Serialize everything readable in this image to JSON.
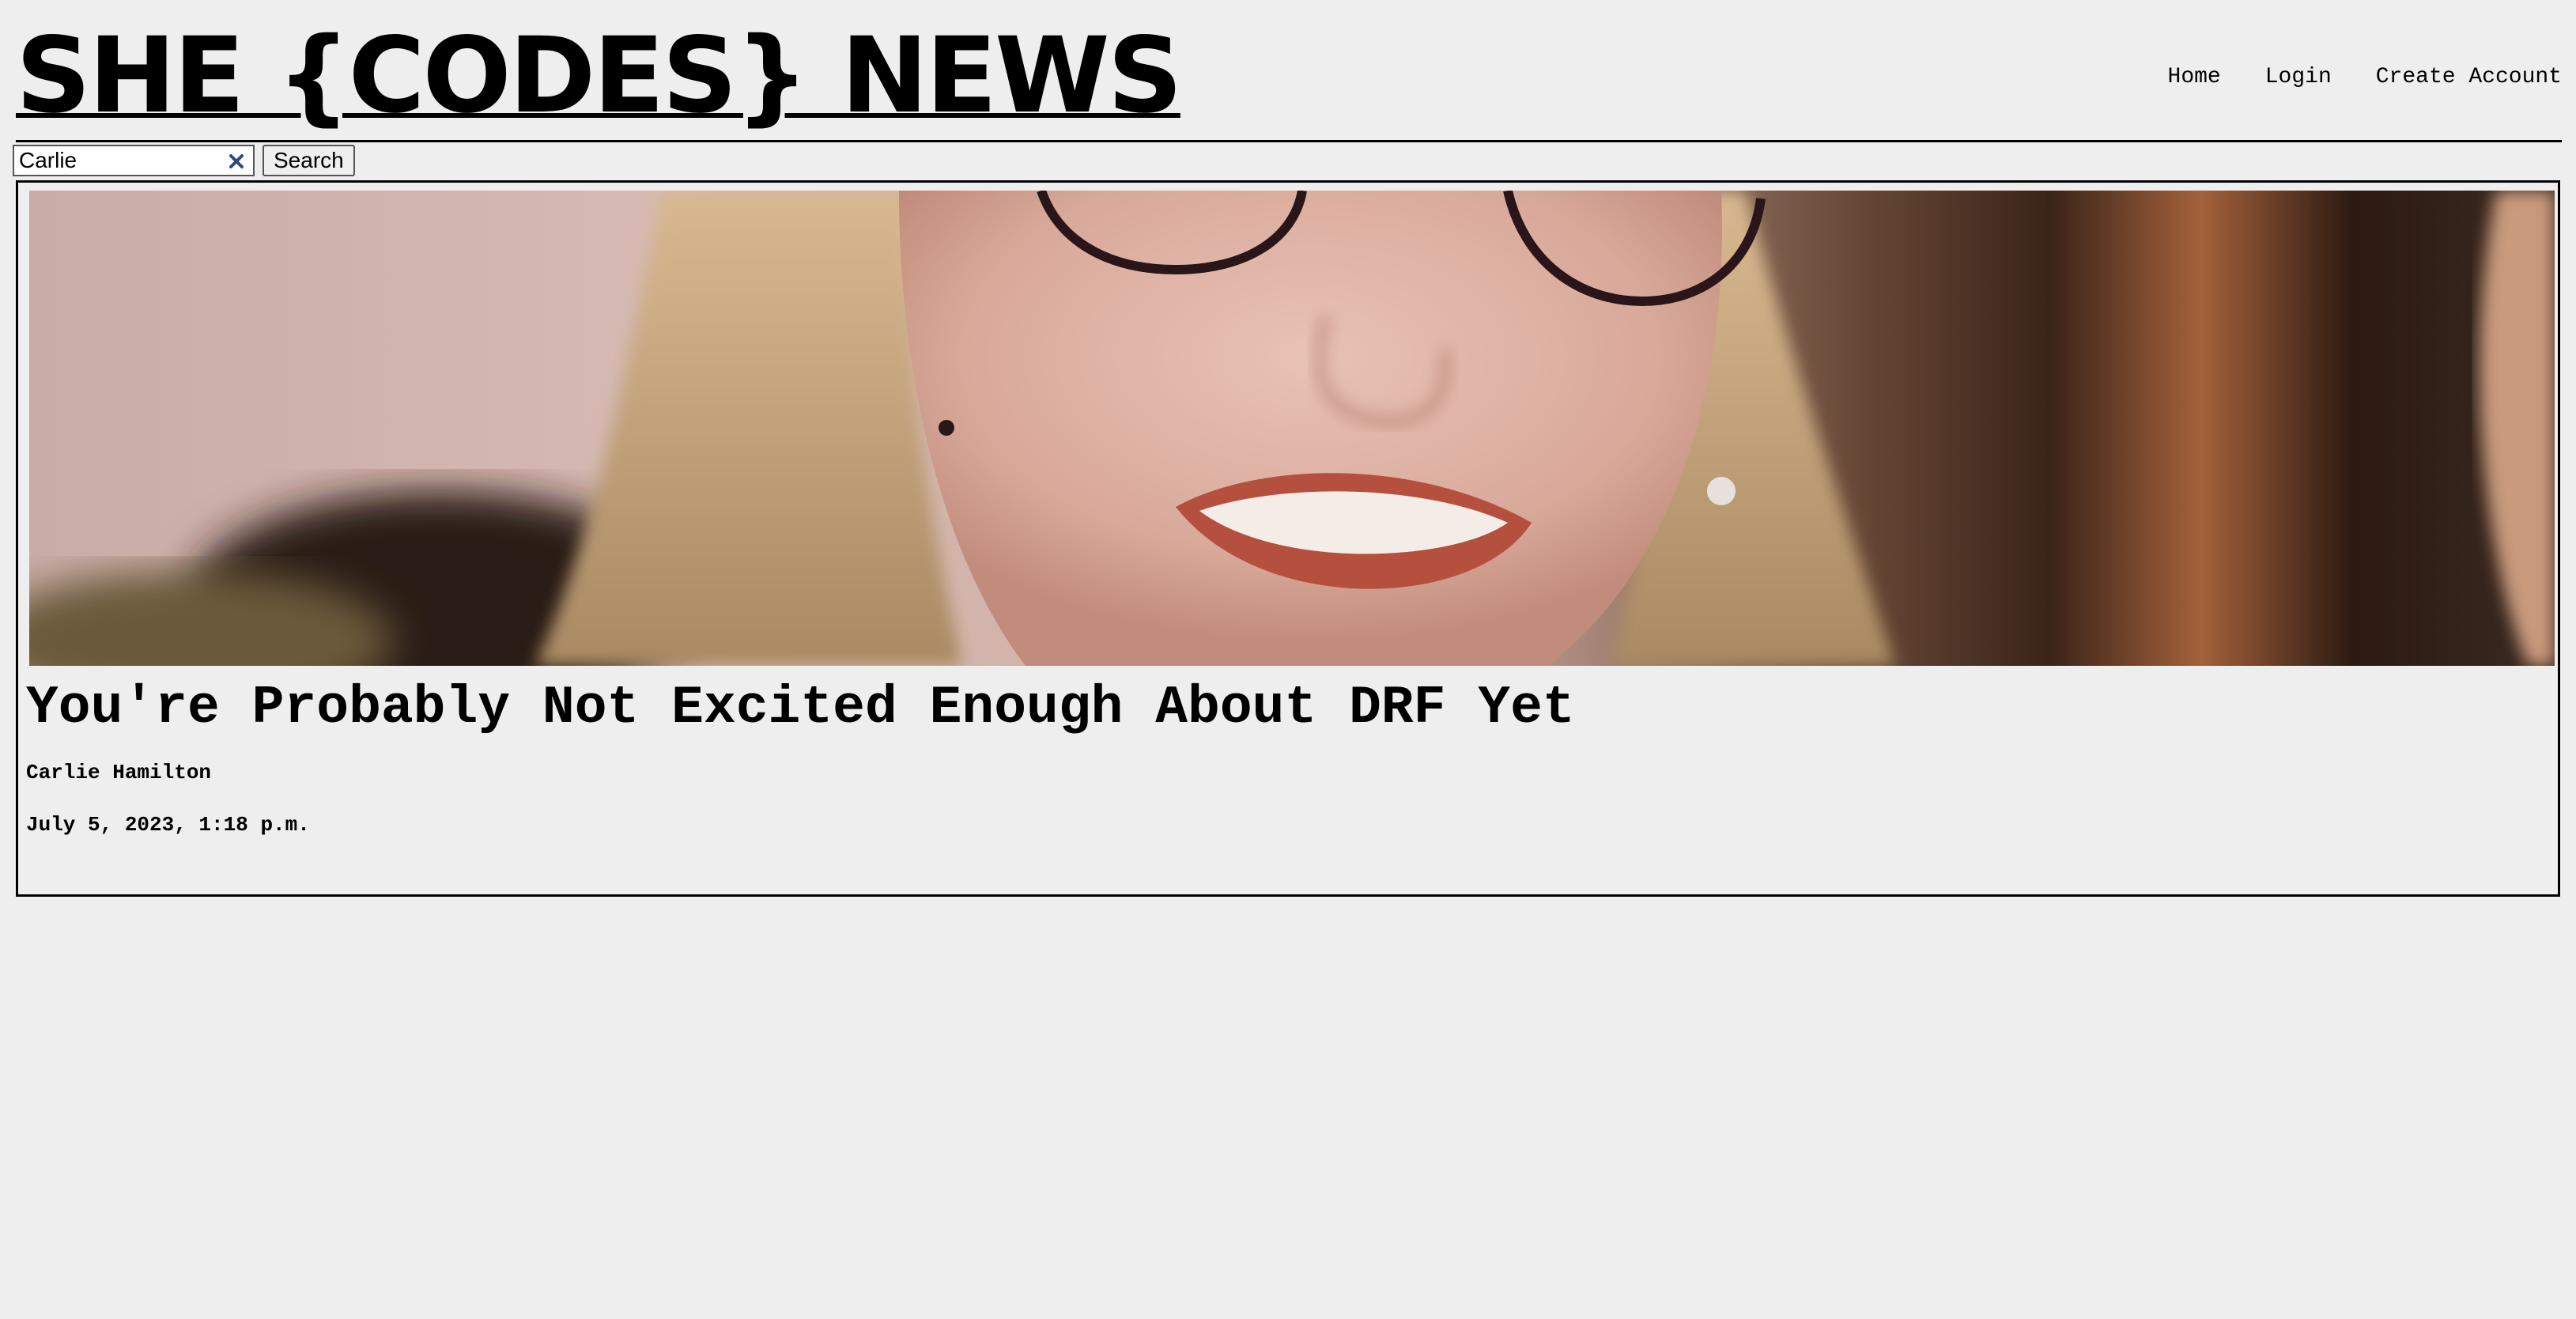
{
  "header": {
    "site_title": "SHE {CODES} NEWS",
    "nav": {
      "home": "Home",
      "login": "Login",
      "create_account": "Create Account"
    }
  },
  "search": {
    "value": "Carlie",
    "button_label": "Search",
    "clear_icon": "close-icon"
  },
  "article": {
    "title": "You're Probably Not Excited Enough About DRF Yet",
    "author": "Carlie Hamilton",
    "date": "July 5, 2023, 1:18 p.m."
  },
  "colors": {
    "page_background": "#eeeeee",
    "text": "#000000",
    "clear_icon": "#2f4a7a"
  }
}
